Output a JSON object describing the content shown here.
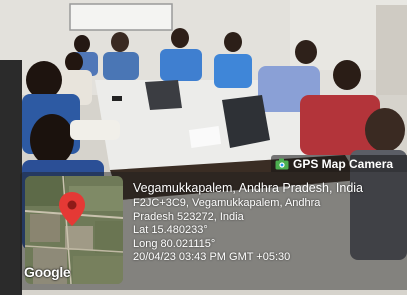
{
  "badge": {
    "label": "GPS Map Camera",
    "icon": "camera-icon"
  },
  "map": {
    "attribution": "Google",
    "pin_icon": "map-pin-icon",
    "pin_color": "#e53935"
  },
  "location": {
    "title": "Vegamukkapalem, Andhra Pradesh, India",
    "address_line1": "F2JC+3C9, Vegamukkapalem, Andhra",
    "address_line2": "Pradesh 523272, India",
    "latitude": "Lat 15.480233°",
    "longitude": "Long 80.021115°",
    "timestamp": "20/04/23 03:43 PM GMT +05:30"
  }
}
